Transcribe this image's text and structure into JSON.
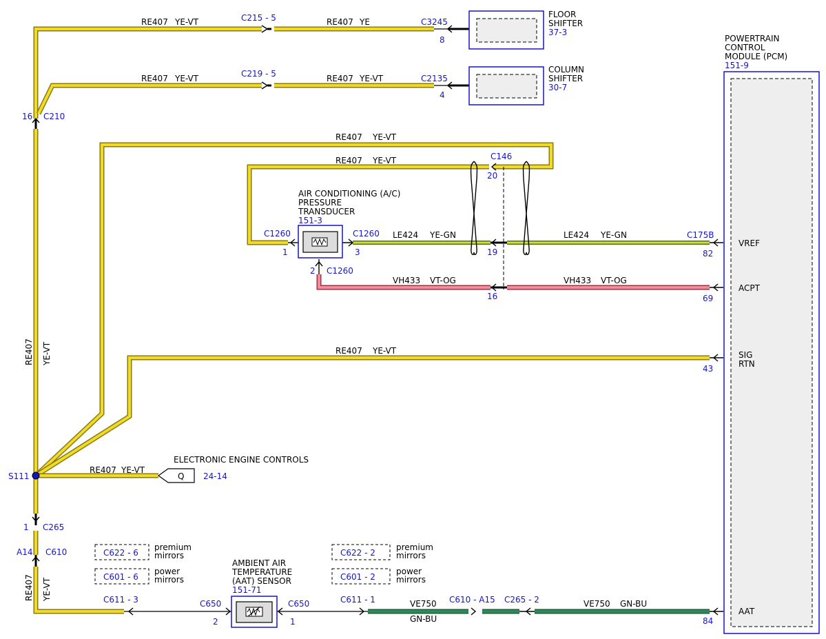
{
  "wires": {
    "re407": "RE407",
    "ye_vt": "YE-VT",
    "ye": "YE",
    "le424": "LE424",
    "ye_gn": "YE-GN",
    "vh433": "VH433",
    "vt_og": "VT-OG",
    "ve750": "VE750",
    "gn_bu": "GN-BU"
  },
  "connectors": {
    "c215_5": "C215 - 5",
    "c219_5": "C219 - 5",
    "c3245": "C3245",
    "c3245_pin": "8",
    "c2135": "C2135",
    "c2135_pin": "4",
    "c210": "C210",
    "c210_pin": "16",
    "c146": "C146",
    "c146_pin20": "20",
    "c146_pin19": "19",
    "c146_pin16": "16",
    "c1260": "C1260",
    "pin1": "1",
    "pin2": "2",
    "pin3": "3",
    "c175b": "C175B",
    "pcm_pin82": "82",
    "pcm_pin69": "69",
    "pcm_pin43": "43",
    "pcm_pin84": "84",
    "s111": "S111",
    "c265": "C265",
    "c265_pin": "1",
    "c610": "C610",
    "c610_pin": "A14",
    "c611_3": "C611 - 3",
    "c650": "C650",
    "c611_1": "C611 - 1",
    "c610_a15": "C610 - A15",
    "c265_2": "C265 - 2",
    "c622_6": "C622 - 6",
    "c601_6": "C601 - 6",
    "c622_2": "C622 - 2",
    "c601_2": "C601 - 2",
    "ref_24_14": "24-14",
    "q": "Q"
  },
  "components": {
    "floor_shifter": [
      "FLOOR",
      "SHIFTER"
    ],
    "floor_shifter_ref": "37-3",
    "column_shifter": [
      "COLUMN",
      "SHIFTER"
    ],
    "column_shifter_ref": "30-7",
    "pcm": [
      "POWERTRAIN",
      "CONTROL",
      "MODULE (PCM)"
    ],
    "pcm_ref": "151-9",
    "ac_transducer": [
      "AIR CONDITIONING (A/C)",
      "PRESSURE",
      "TRANSDUCER"
    ],
    "ac_ref": "151-3",
    "aat_sensor": [
      "AMBIENT AIR",
      "TEMPERATURE",
      "(AAT) SENSOR"
    ],
    "aat_ref": "151-71",
    "eec": "ELECTRONIC ENGINE CONTROLS",
    "premium": [
      "premium",
      "mirrors"
    ],
    "power": [
      "power",
      "mirrors"
    ]
  },
  "pcm_pins": {
    "vref": "VREF",
    "acpt": "ACPT",
    "sig_rtn": [
      "SIG",
      "RTN"
    ],
    "aat": "AAT"
  },
  "colors": {
    "ye": "#f0dc28",
    "gn": "#9ac83c",
    "vt_og": "#f08ca0",
    "gn_bu": "#2a7a4a",
    "blue": "#1515c8"
  }
}
